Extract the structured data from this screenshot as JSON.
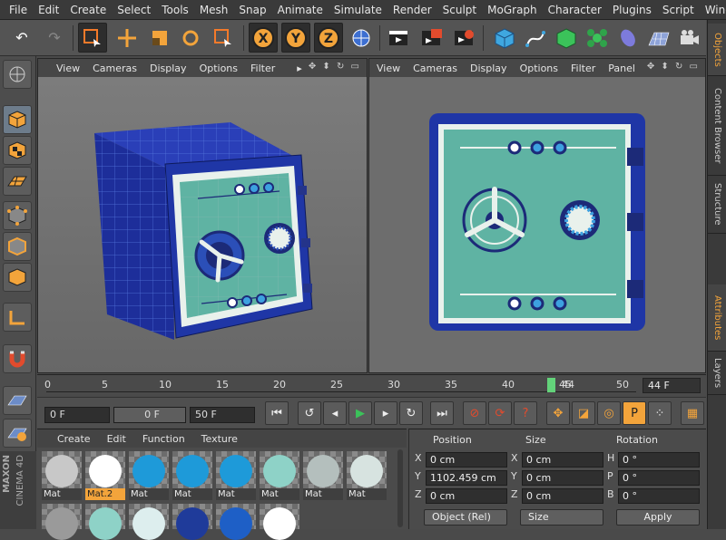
{
  "menu": [
    "File",
    "Edit",
    "Create",
    "Select",
    "Tools",
    "Mesh",
    "Snap",
    "Animate",
    "Simulate",
    "Render",
    "Sculpt",
    "MoGraph",
    "Character",
    "Plugins",
    "Script",
    "Window"
  ],
  "viewport_left": {
    "menu": [
      "View",
      "Cameras",
      "Display",
      "Options",
      "Filter"
    ]
  },
  "viewport_right": {
    "menu": [
      "View",
      "Cameras",
      "Display",
      "Options",
      "Filter",
      "Panel"
    ]
  },
  "right_tabs": [
    "Objects",
    "Content Browser",
    "Structure",
    "Attributes",
    "Layers"
  ],
  "timeline": {
    "ticks": [
      "0",
      "5",
      "10",
      "15",
      "20",
      "25",
      "30",
      "35",
      "40",
      "45",
      "50"
    ],
    "current_frame": "44",
    "end_field": "44 F",
    "current_fraction": 0.88
  },
  "transport": {
    "start": "0 F",
    "preview_start": "0 F",
    "end": "50 F"
  },
  "materials": {
    "menu": [
      "Create",
      "Edit",
      "Function",
      "Texture"
    ],
    "items": [
      {
        "label": "Mat",
        "color": "#c8c8c8",
        "selected": false
      },
      {
        "label": "Mat.2",
        "color": "#ffffff",
        "selected": true
      },
      {
        "label": "Mat",
        "color": "#1e9ad9",
        "selected": false
      },
      {
        "label": "Mat",
        "color": "#1e9ad9",
        "selected": false
      },
      {
        "label": "Mat",
        "color": "#1e9ad9",
        "selected": false
      },
      {
        "label": "Mat",
        "color": "#8ed2c7",
        "selected": false
      },
      {
        "label": "Mat",
        "color": "#b4bfbd",
        "selected": false
      },
      {
        "label": "Mat",
        "color": "#d7e3e0",
        "selected": false
      }
    ],
    "second_row_colors": [
      "#9a9a9a",
      "#8ed2c7",
      "#ddeeee",
      "#1f3b9a",
      "#1e5fc6",
      "#ffffff"
    ]
  },
  "attributes": {
    "headers": {
      "position": "Position",
      "size": "Size",
      "rotation": "Rotation"
    },
    "rows": [
      {
        "axis": "X",
        "position": "0 cm",
        "size_axis": "X",
        "size": "0 cm",
        "rot_axis": "H",
        "rotation": "0 °"
      },
      {
        "axis": "Y",
        "position": "1102.459 cm",
        "size_axis": "Y",
        "size": "0 cm",
        "rot_axis": "P",
        "rotation": "0 °"
      },
      {
        "axis": "Z",
        "position": "0 cm",
        "size_axis": "Z",
        "size": "0 cm",
        "rot_axis": "B",
        "rotation": "0 °"
      }
    ],
    "coord_mode": "Object (Rel)",
    "size_mode": "Size",
    "apply": "Apply"
  },
  "brand": {
    "line1": "MAXON",
    "line2": "CINEMA 4D"
  },
  "colors": {
    "accent": "#f3a43b",
    "safe_blue": "#1f3b9a",
    "safe_teal": "#5fb3a3"
  }
}
